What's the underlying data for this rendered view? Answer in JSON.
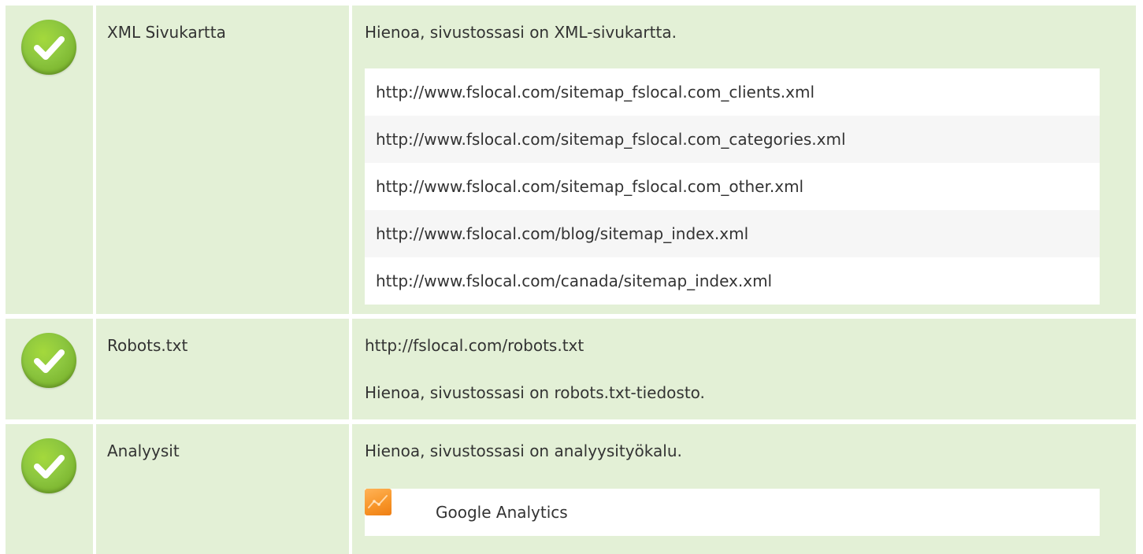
{
  "rows": [
    {
      "label": "XML Sivukartta",
      "message": "Hienoa, sivustossasi on XML-sivukartta.",
      "sitemaps": [
        "http://www.fslocal.com/sitemap_fslocal.com_clients.xml",
        "http://www.fslocal.com/sitemap_fslocal.com_categories.xml",
        "http://www.fslocal.com/sitemap_fslocal.com_other.xml",
        "http://www.fslocal.com/blog/sitemap_index.xml",
        "http://www.fslocal.com/canada/sitemap_index.xml"
      ]
    },
    {
      "label": "Robots.txt",
      "url": "http://fslocal.com/robots.txt",
      "message": "Hienoa, sivustossasi on robots.txt-tiedosto."
    },
    {
      "label": "Analyysit",
      "message": "Hienoa, sivustossasi on analyysityökalu.",
      "tool": "Google Analytics"
    }
  ],
  "colors": {
    "row_bg": "#e3f0d6",
    "check_green": "#8cc63f",
    "analytics_orange": "#f79427"
  },
  "icons": {
    "status": "check-circle-icon",
    "analytics": "google-analytics-icon"
  }
}
